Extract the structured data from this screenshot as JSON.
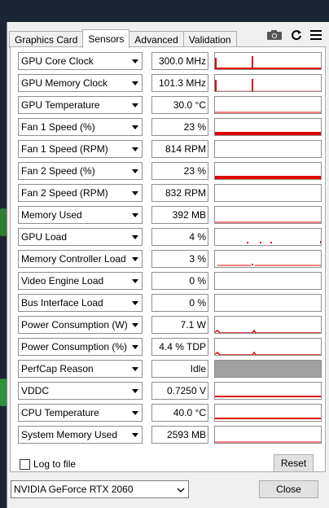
{
  "tabs": [
    {
      "label": "Graphics Card",
      "active": false
    },
    {
      "label": "Sensors",
      "active": true
    },
    {
      "label": "Advanced",
      "active": false
    },
    {
      "label": "Validation",
      "active": false
    }
  ],
  "toolbar_icons": [
    "camera-icon",
    "refresh-icon",
    "menu-icon"
  ],
  "colors": {
    "graph_line": "#e00000",
    "perfcap_fill": "#a0a0a0",
    "desktop_bg": "#1b2533"
  },
  "sensors": [
    {
      "name": "GPU Core Clock",
      "value": "300.0 MHz",
      "graph": "spikes"
    },
    {
      "name": "GPU Memory Clock",
      "value": "101.3 MHz",
      "graph": "spikes-low"
    },
    {
      "name": "GPU Temperature",
      "value": "30.0 °C",
      "graph": "flat-low"
    },
    {
      "name": "Fan 1 Speed (%)",
      "value": "23 %",
      "graph": "flat-thick"
    },
    {
      "name": "Fan 1 Speed (RPM)",
      "value": "814 RPM",
      "graph": "none"
    },
    {
      "name": "Fan 2 Speed (%)",
      "value": "23 %",
      "graph": "flat-thick"
    },
    {
      "name": "Fan 2 Speed (RPM)",
      "value": "832 RPM",
      "graph": "none"
    },
    {
      "name": "Memory Used",
      "value": "392 MB",
      "graph": "flat-low"
    },
    {
      "name": "GPU Load",
      "value": "4 %",
      "graph": "dots"
    },
    {
      "name": "Memory Controller Load",
      "value": "3 %",
      "graph": "gap-line"
    },
    {
      "name": "Video Engine Load",
      "value": "0 %",
      "graph": "none"
    },
    {
      "name": "Bus Interface Load",
      "value": "0 %",
      "graph": "none"
    },
    {
      "name": "Power Consumption (W)",
      "value": "7.1 W",
      "graph": "bumpy"
    },
    {
      "name": "Power Consumption (%)",
      "value": "4.4 % TDP",
      "graph": "bumpy"
    },
    {
      "name": "PerfCap Reason",
      "value": "Idle",
      "graph": "gray-block"
    },
    {
      "name": "VDDC",
      "value": "0.7250 V",
      "graph": "flat-mid"
    },
    {
      "name": "CPU Temperature",
      "value": "40.0 °C",
      "graph": "flat-mid"
    },
    {
      "name": "System Memory Used",
      "value": "2593 MB",
      "graph": "flat-low"
    }
  ],
  "log_to_file": {
    "label": "Log to file",
    "checked": false
  },
  "reset_label": "Reset",
  "gpu_select": {
    "value": "NVIDIA GeForce RTX 2060"
  },
  "close_label": "Close"
}
